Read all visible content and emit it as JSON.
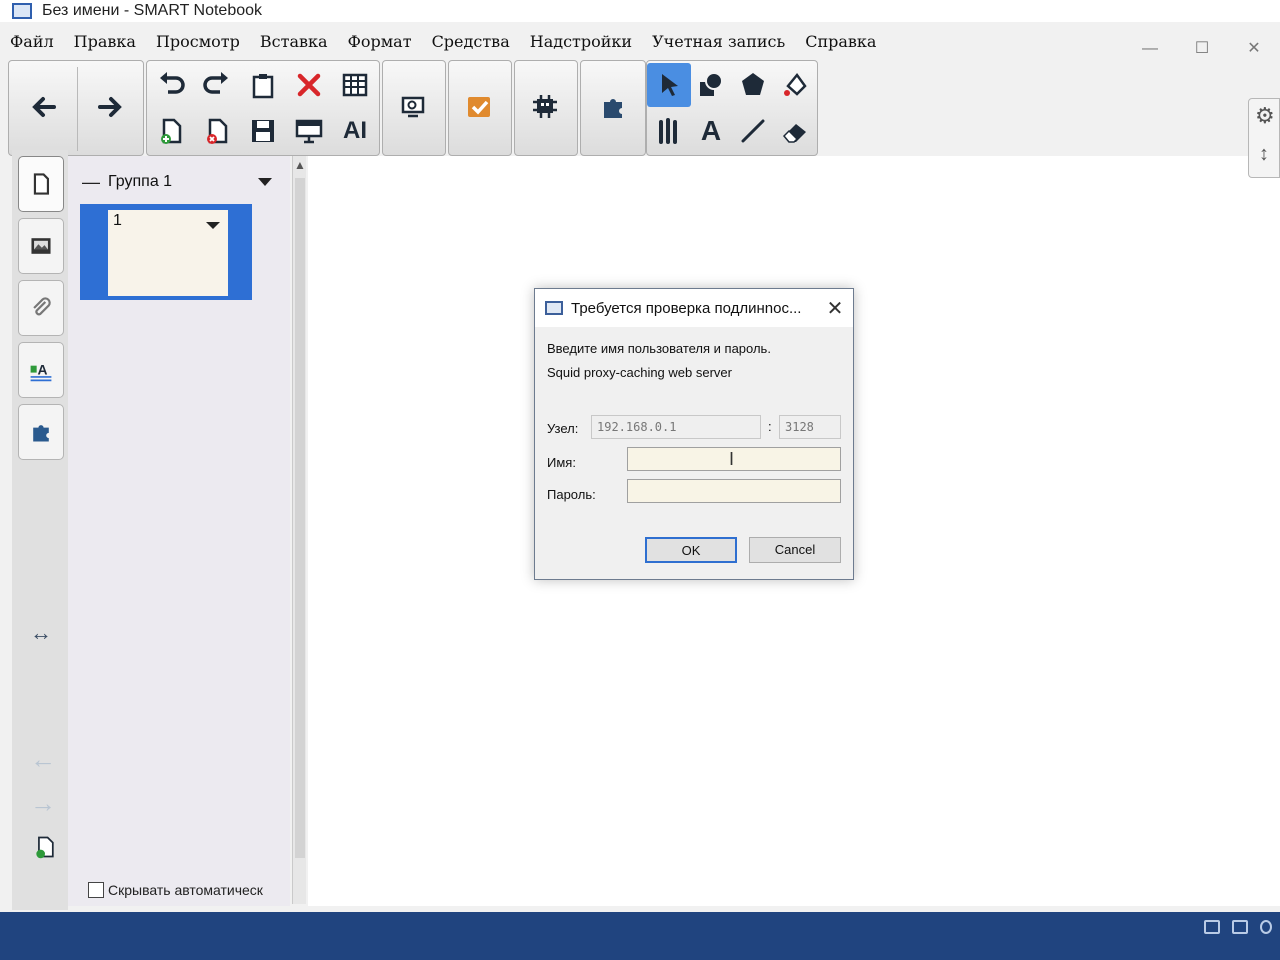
{
  "window": {
    "title": "Без имени - SMART Notebook"
  },
  "menubar": {
    "items": [
      "Файл",
      "Правка",
      "Просмотр",
      "Вставка",
      "Формат",
      "Средства",
      "Надстройки",
      "Учетная запись",
      "Справка"
    ]
  },
  "window_controls": {
    "minimize": "—",
    "maximize": "☐",
    "close": "✕"
  },
  "toolbar": {
    "icons": [
      "back-arrow-icon",
      "forward-arrow-icon",
      "undo-icon",
      "redo-icon",
      "paste-icon",
      "delete-icon",
      "table-icon",
      "add-page-icon",
      "delete-page-icon",
      "save-icon",
      "screen-shade-icon",
      "ai-text-icon",
      "document-camera-icon",
      "response-icon",
      "activity-icon",
      "addons-icon",
      "select-icon",
      "shapes-icon",
      "shape-fill-icon",
      "fill-icon",
      "pens-icon",
      "text-icon",
      "line-icon",
      "eraser-icon"
    ],
    "active_color": "#4a8ee2"
  },
  "sidebar": {
    "tabs": [
      "page-sorter-icon",
      "gallery-icon",
      "attachments-icon",
      "properties-icon",
      "addons-icon"
    ],
    "group_label": "Группа 1",
    "pages": [
      {
        "number": "1"
      }
    ],
    "autohide_label": "Скрывать автоматическ",
    "autohide_checked": false
  },
  "dialog": {
    "title": "Требуется проверка подлинnос...",
    "prompt": "Введите имя пользователя и пароль.",
    "server": "Squid proxy-caching web server",
    "host_label": "Узел:",
    "host_value": "192.168.0.1",
    "port_separator": ":",
    "port_value": "3128",
    "name_label": "Имя:",
    "name_value": "",
    "password_label": "Пароль:",
    "password_value": "",
    "ok_label": "OK",
    "cancel_label": "Cancel"
  },
  "colors": {
    "selection": "#2e6fd4",
    "taskbar": "#20447f",
    "dialog_focus": "#2f6fd0"
  }
}
